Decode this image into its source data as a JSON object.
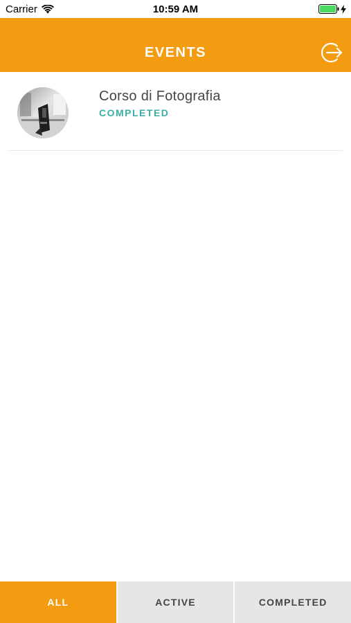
{
  "status_bar": {
    "carrier": "Carrier",
    "time": "10:59 AM",
    "wifi_icon": "wifi-icon",
    "battery_icon": "battery-icon",
    "charging_icon": "bolt-icon",
    "battery_color": "#4cd964"
  },
  "header": {
    "title": "EVENTS",
    "logout_icon": "logout-icon",
    "background": "#f39c12"
  },
  "events": [
    {
      "title": "Corso di Fotografia",
      "status": "COMPLETED",
      "status_color": "#3aaea5",
      "image": "photography-camera-thumbnail"
    }
  ],
  "tabs": [
    {
      "label": "ALL",
      "selected": true
    },
    {
      "label": "ACTIVE",
      "selected": false
    },
    {
      "label": "COMPLETED",
      "selected": false
    }
  ]
}
